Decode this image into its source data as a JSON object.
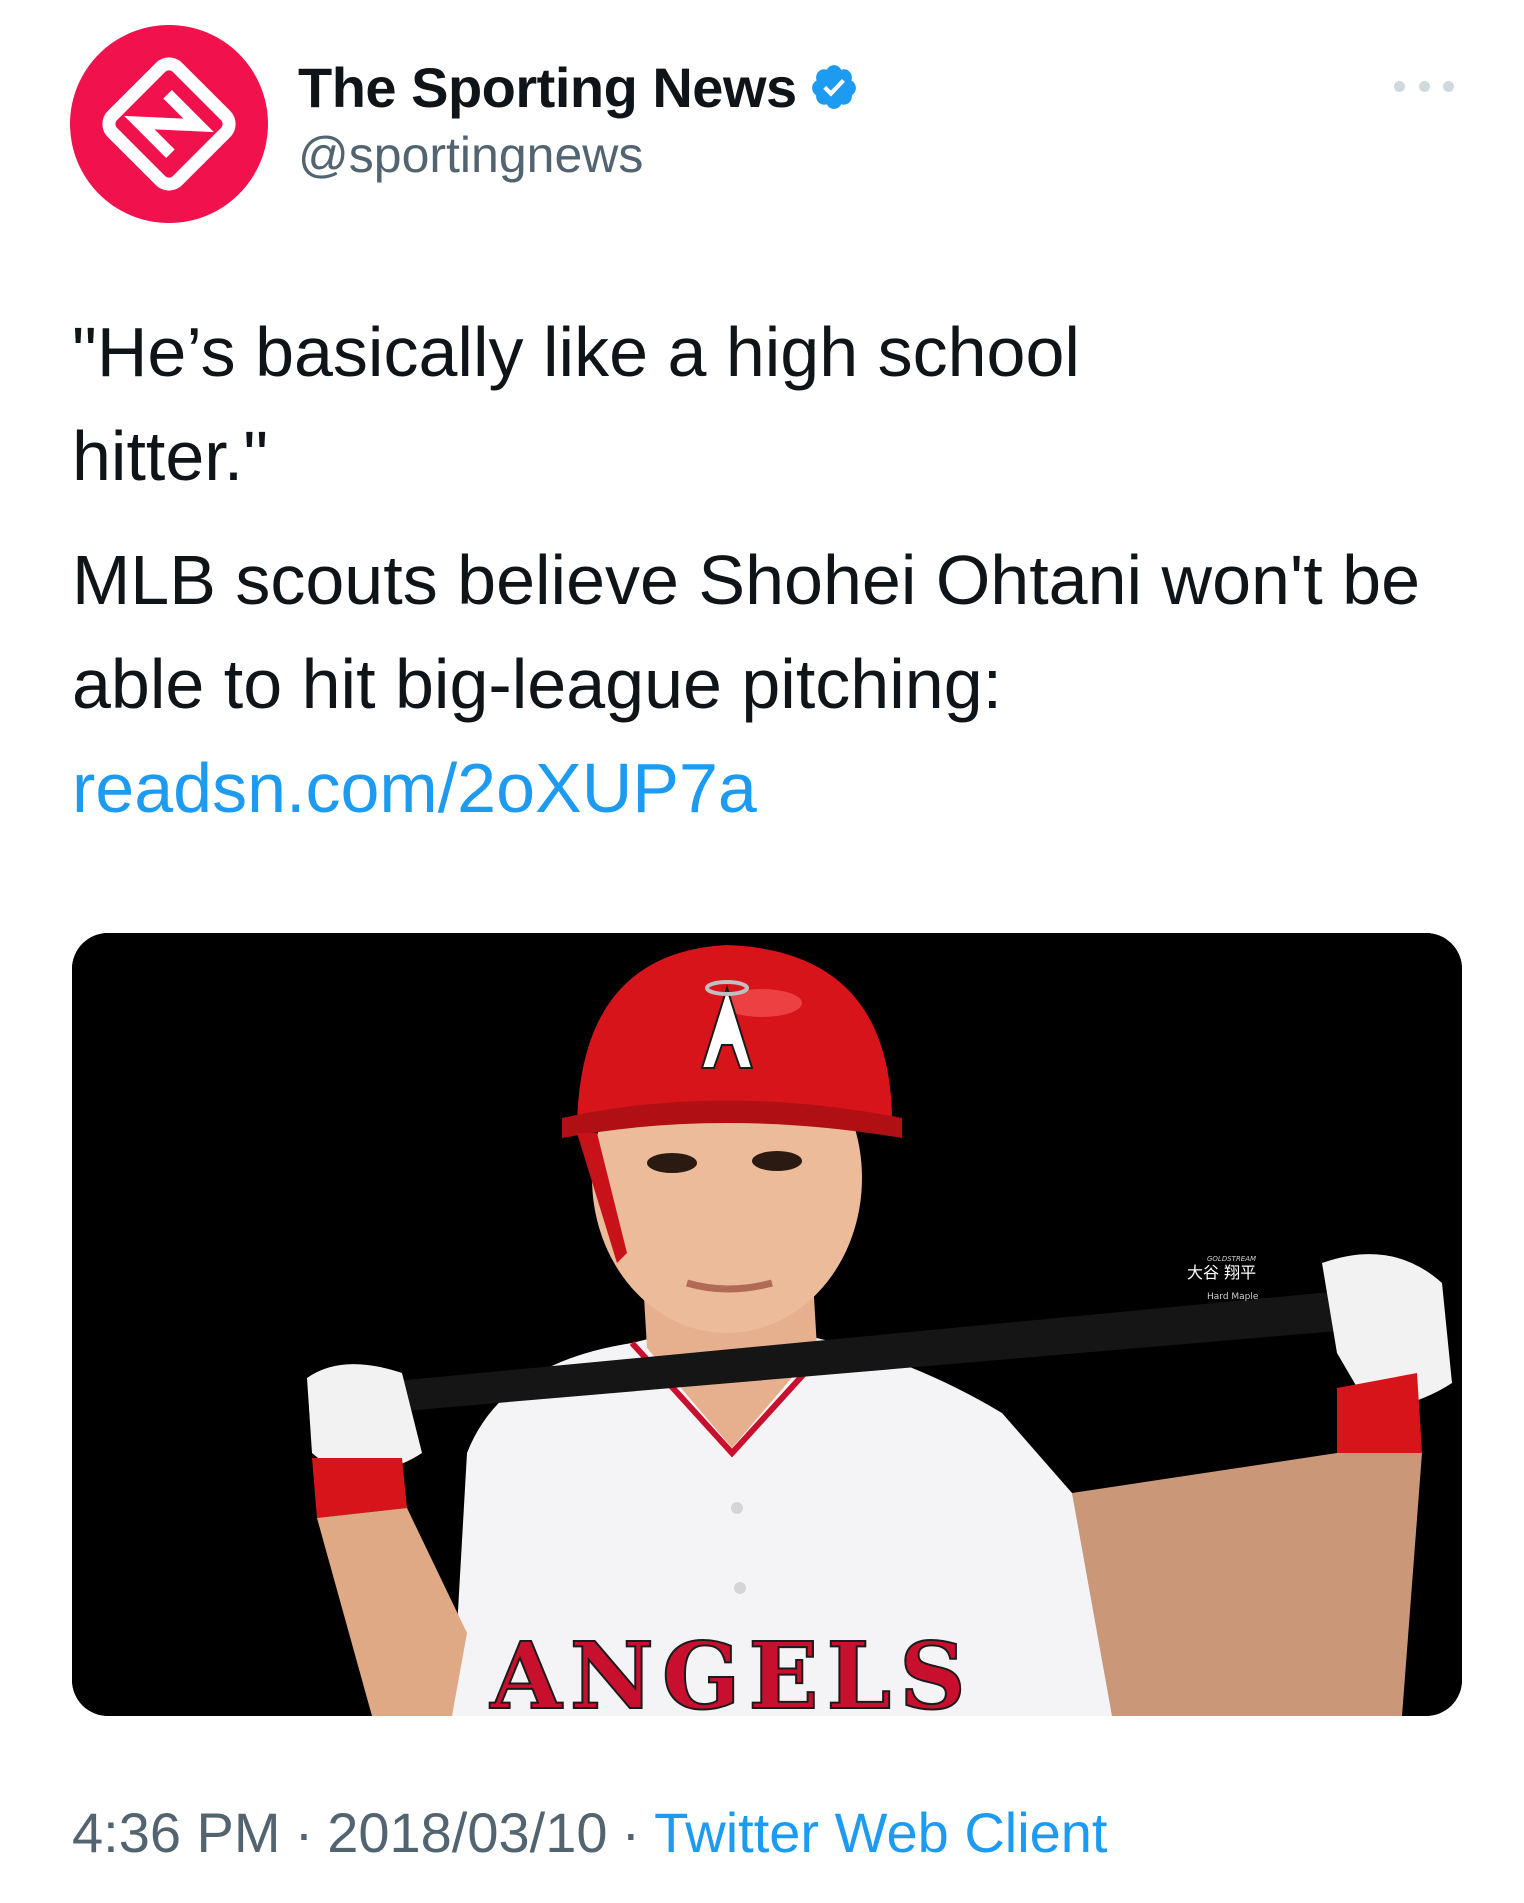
{
  "author": {
    "display_name": "The Sporting News",
    "handle": "@sportingnews",
    "verified": true,
    "avatar_color": "#f0114d"
  },
  "tweet": {
    "quote_line": "\"He’s basically like a high school hitter.\"",
    "body_line": "MLB scouts believe Shohei Ohtani won't be able to hit big-league pitching:",
    "link_text": "readsn.com/2oXUP7a",
    "media": {
      "jersey_text": "ANGELS",
      "bat_text": "大谷 翔平",
      "bat_subtext": "Hard Maple",
      "bat_brand": "GOLDSTREAM"
    }
  },
  "footer": {
    "time": "4:36 PM",
    "separator": "·",
    "date": "2018/03/10",
    "client": "Twitter Web Client"
  },
  "colors": {
    "link": "#1d9bf0",
    "secondary_text": "#536471",
    "verified": "#1d9bf0",
    "helmet": "#d8141b",
    "jersey": "#f4f4f6"
  }
}
